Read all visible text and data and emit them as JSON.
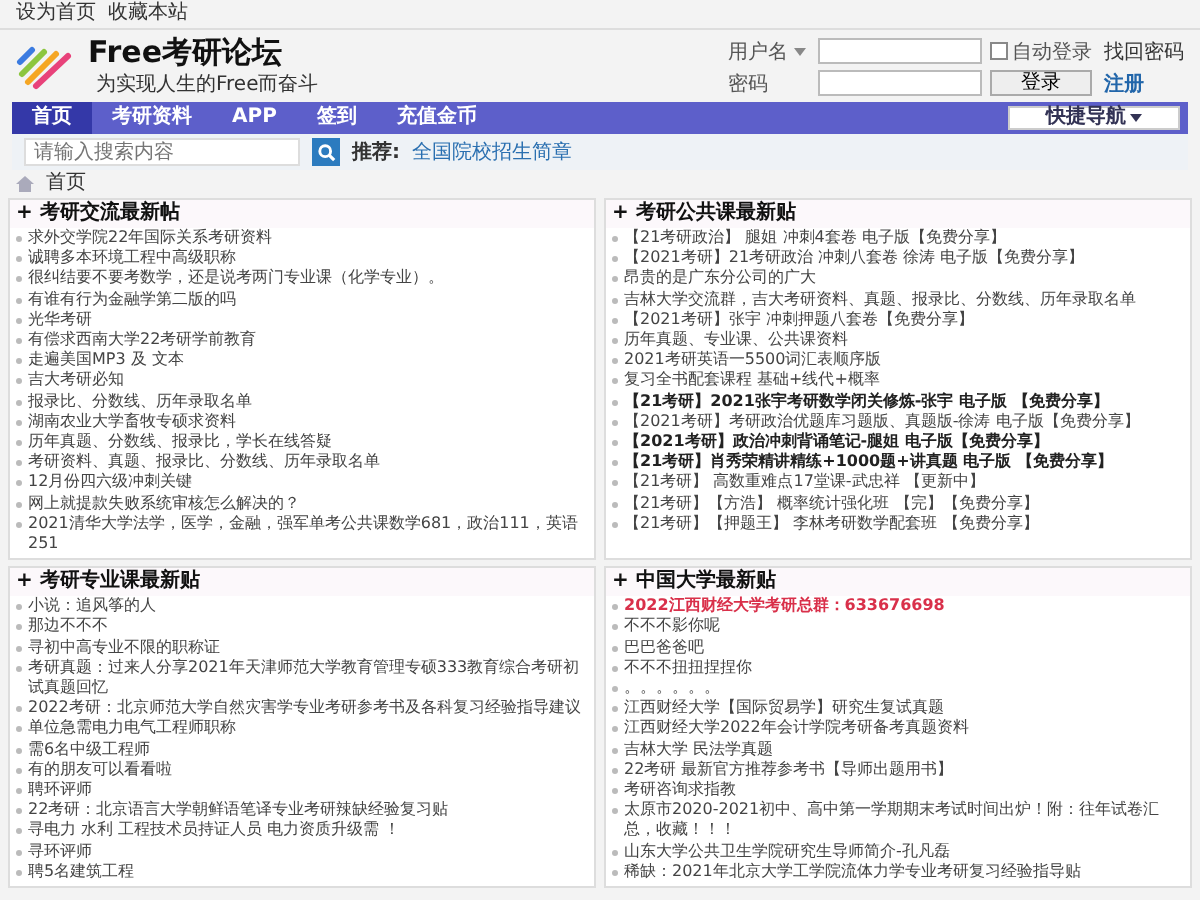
{
  "top_links": [
    "设为首页",
    "收藏本站"
  ],
  "logo": {
    "title": "Free考研论坛",
    "slogan": "为实现人生的Free而奋斗"
  },
  "login": {
    "username_label": "用户名",
    "auto_login": {
      "label": "自动登录",
      "checked": false
    },
    "forgot": "找回密码",
    "password_label": "密码",
    "button": "登录",
    "register": "注册"
  },
  "nav": {
    "items": [
      {
        "label": "首页",
        "selected": true
      },
      {
        "label": "考研资料",
        "selected": false
      },
      {
        "label": "APP",
        "selected": false
      },
      {
        "label": "签到",
        "selected": false
      },
      {
        "label": "充值金币",
        "selected": false
      }
    ],
    "quick_nav": "快捷导航"
  },
  "search": {
    "placeholder": "请输入搜索内容",
    "recommend_label": "推荐:",
    "recommend_link": "全国院校招生简章"
  },
  "breadcrumb": [
    "首页"
  ],
  "panels": [
    {
      "title": "+ 考研交流最新帖",
      "posts": [
        {
          "text": "求外交学院22年国际关系考研资料",
          "kind": "normal"
        },
        {
          "text": "诚聘多本环境工程中高级职称",
          "kind": "normal"
        },
        {
          "text": "很纠结要不要考数学，还是说考两门专业课（化学专业）。",
          "kind": "normal"
        },
        {
          "text": "有谁有行为金融学第二版的吗",
          "kind": "normal"
        },
        {
          "text": "光华考研",
          "kind": "normal"
        },
        {
          "text": "有偿求西南大学22考研学前教育",
          "kind": "normal"
        },
        {
          "text": "走遍美国MP3 及 文本",
          "kind": "normal"
        },
        {
          "text": "吉大考研必知",
          "kind": "normal"
        },
        {
          "text": "报录比、分数线、历年录取名单",
          "kind": "normal"
        },
        {
          "text": "湖南农业大学畜牧专硕求资料",
          "kind": "normal"
        },
        {
          "text": "历年真题、分数线、报录比，学长在线答疑",
          "kind": "normal"
        },
        {
          "text": "考研资料、真题、报录比、分数线、历年录取名单",
          "kind": "normal"
        },
        {
          "text": "12月份四六级冲刺关键",
          "kind": "normal"
        },
        {
          "text": "网上就提款失败系统审核怎么解决的？",
          "kind": "normal"
        },
        {
          "text": "2021清华大学法学，医学，金融，强军单考公共课数学681，政治111，英语251",
          "kind": "normal"
        }
      ]
    },
    {
      "title": "+ 考研公共课最新贴",
      "posts": [
        {
          "text": "【21考研政治】 腿姐 冲刺4套卷 电子版【免费分享】",
          "kind": "normal"
        },
        {
          "text": "【2021考研】21考研政治 冲刺八套卷 徐涛 电子版【免费分享】",
          "kind": "normal"
        },
        {
          "text": "昂贵的是广东分公司的广大",
          "kind": "normal"
        },
        {
          "text": "吉林大学交流群，吉大考研资料、真题、报录比、分数线、历年录取名单",
          "kind": "normal"
        },
        {
          "text": "【2021考研】张宇 冲刺押题八套卷【免费分享】",
          "kind": "normal"
        },
        {
          "text": "历年真题、专业课、公共课资料",
          "kind": "normal"
        },
        {
          "text": "2021考研英语一5500词汇表顺序版",
          "kind": "normal"
        },
        {
          "text": "复习全书配套课程 基础+线代+概率",
          "kind": "normal"
        },
        {
          "text": "【21考研】2021张宇考研数学闭关修炼-张宇 电子版 【免费分享】",
          "kind": "bold"
        },
        {
          "text": "【2021考研】考研政治优题库习题版、真题版-徐涛 电子版【免费分享】",
          "kind": "normal"
        },
        {
          "text": "【2021考研】政治冲刺背诵笔记-腿姐 电子版【免费分享】",
          "kind": "bold"
        },
        {
          "text": "【21考研】肖秀荣精讲精练+1000题+讲真题 电子版 【免费分享】",
          "kind": "bold"
        },
        {
          "text": "【21考研】 高数重难点17堂课-武忠祥 【更新中】",
          "kind": "normal"
        },
        {
          "text": "【21考研】【方浩】 概率统计强化班 【完】【免费分享】",
          "kind": "normal"
        },
        {
          "text": "【21考研】【押题王】 李林考研数学配套班 【免费分享】",
          "kind": "normal"
        }
      ]
    },
    {
      "title": "+ 考研专业课最新贴",
      "posts": [
        {
          "text": "小说：追风筝的人",
          "kind": "normal"
        },
        {
          "text": "那边不不不",
          "kind": "normal"
        },
        {
          "text": "寻初中高专业不限的职称证",
          "kind": "normal"
        },
        {
          "text": "考研真题：过来人分享2021年天津师范大学教育管理专硕333教育综合考研初试真题回忆",
          "kind": "normal"
        },
        {
          "text": "2022考研：北京师范大学自然灾害学专业考研参考书及各科复习经验指导建议",
          "kind": "normal"
        },
        {
          "text": "单位急需电力电气工程师职称",
          "kind": "normal"
        },
        {
          "text": "需6名中级工程师",
          "kind": "normal"
        },
        {
          "text": "有的朋友可以看看啦",
          "kind": "normal"
        },
        {
          "text": "聘环评师",
          "kind": "normal"
        },
        {
          "text": "22考研：北京语言大学朝鲜语笔译专业考研辣缺经验复习贴",
          "kind": "normal"
        },
        {
          "text": "寻电力 水利 工程技术员持证人员 电力资质升级需 ！",
          "kind": "normal"
        },
        {
          "text": "寻环评师",
          "kind": "normal"
        },
        {
          "text": "聘5名建筑工程",
          "kind": "normal"
        }
      ]
    },
    {
      "title": "+ 中国大学最新贴",
      "posts": [
        {
          "text": "2022江西财经大学考研总群：633676698",
          "kind": "highlight"
        },
        {
          "text": "不不不影你呢",
          "kind": "normal"
        },
        {
          "text": "巴巴爸爸吧",
          "kind": "normal"
        },
        {
          "text": "不不不扭扭捏捏你",
          "kind": "normal"
        },
        {
          "text": "。。。。。。",
          "kind": "normal"
        },
        {
          "text": "江西财经大学【国际贸易学】研究生复试真题",
          "kind": "normal"
        },
        {
          "text": "江西财经大学2022年会计学院考研备考真题资料",
          "kind": "normal"
        },
        {
          "text": "吉林大学 民法学真题",
          "kind": "normal"
        },
        {
          "text": "22考研 最新官方推荐参考书【导师出题用书】",
          "kind": "normal"
        },
        {
          "text": "考研咨询求指教",
          "kind": "normal"
        },
        {
          "text": "太原市2020-2021初中、高中第一学期期末考试时间出炉！附：往年试卷汇总，收藏！！！",
          "kind": "normal"
        },
        {
          "text": "山东大学公共卫生学院研究生导师简介-孔凡磊",
          "kind": "normal"
        },
        {
          "text": "稀缺：2021年北京大学工学院流体力学专业考研复习经验指导贴",
          "kind": "normal"
        }
      ]
    }
  ]
}
